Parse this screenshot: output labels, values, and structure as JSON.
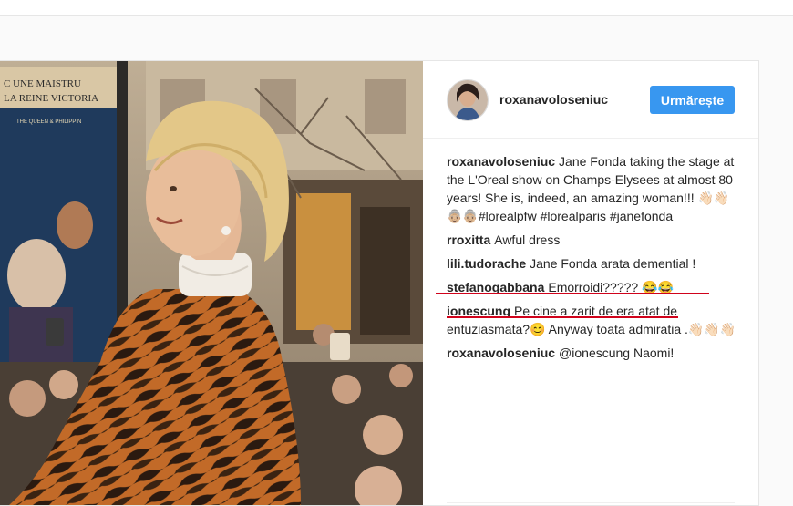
{
  "colors": {
    "accent": "#3897f0",
    "underline": "#d0021b",
    "dress_orange": "#c26a28",
    "dress_stripe": "#2b1a10"
  },
  "icons": {
    "avatar": "profile-photo",
    "emoji": [
      "raised-hand-emoji",
      "grinning-emoji",
      "smiling-emoji",
      "older-woman-emoji"
    ]
  },
  "post": {
    "author": "roxanavoloseniuc",
    "follow_label": "Urmărește",
    "photo_sign": {
      "line1": "C UNE MAISTRU",
      "line2": "LA REINE VICTORIA",
      "line3": "THE QUEEN & PHILIPPIN"
    }
  },
  "comments": [
    {
      "user": "roxanavoloseniuc",
      "text": "Jane Fonda taking the stage at the L'Oreal show on Champs-Elysees at almost 80 years! She is, indeed, an amazing woman!!! 👋🏻👋🏻👵🏼👵🏼#lorealpfw #lorealparis #janefonda"
    },
    {
      "user": "rroxitta",
      "text": "Awful dress"
    },
    {
      "user": "lili.tudorache",
      "text": "Jane Fonda arata demential !"
    },
    {
      "user": "stefanogabbana",
      "text": "Emorroidi????? 😂😂"
    },
    {
      "user": "ionescung",
      "text": "Pe cine a zarit de era atat de entuziasmata?😊 Anyway toata admiratia .👋🏻👋🏻👋🏻"
    },
    {
      "user": "roxanavoloseniuc",
      "text": "@ionescung Naomi!"
    }
  ]
}
